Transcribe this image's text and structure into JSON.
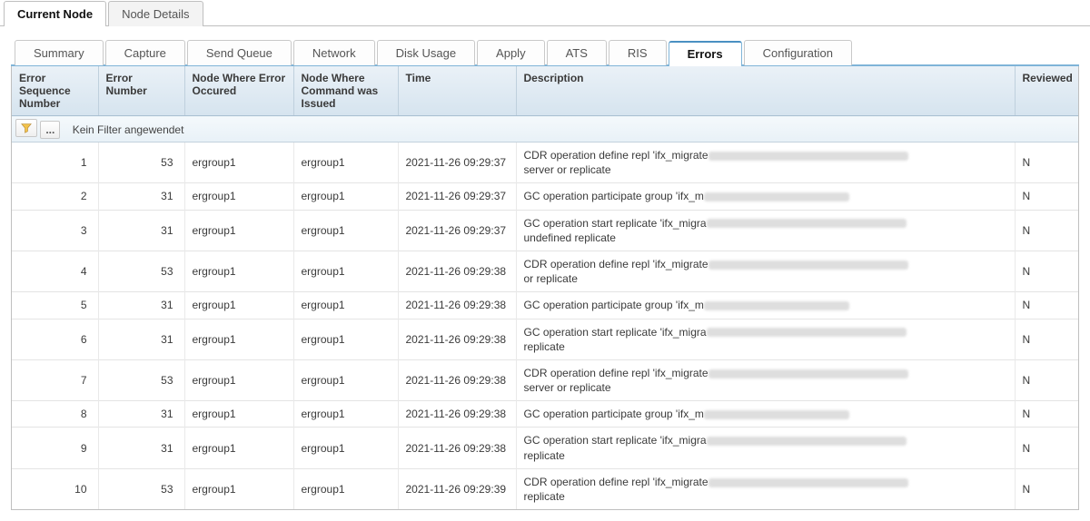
{
  "outer_tabs": {
    "current_node": "Current Node",
    "node_details": "Node Details"
  },
  "inner_tabs": {
    "summary": "Summary",
    "capture": "Capture",
    "send_queue": "Send Queue",
    "network": "Network",
    "disk_usage": "Disk Usage",
    "apply": "Apply",
    "ats": "ATS",
    "ris": "RIS",
    "errors": "Errors",
    "configuration": "Configuration"
  },
  "columns": {
    "error_seq": "Error Sequence Number",
    "error_num": "Error Number",
    "node_occurred": "Node Where Error Occured",
    "node_issued": "Node Where Command was Issued",
    "time": "Time",
    "description": "Description",
    "reviewed": "Reviewed"
  },
  "filter": {
    "text": "Kein Filter angewendet",
    "dots": "..."
  },
  "rows": [
    {
      "seq": "1",
      "err": "53",
      "nwo": "ergroup1",
      "nwc": "ergroup1",
      "time": "2021-11-26 09:29:37",
      "desc_prefix": "CDR operation define repl 'ifx_migrate",
      "desc_suffix": " server or replicate",
      "rev": "N"
    },
    {
      "seq": "2",
      "err": "31",
      "nwo": "ergroup1",
      "nwc": "ergroup1",
      "time": "2021-11-26 09:29:37",
      "desc_prefix": "GC operation participate group 'ifx_m",
      "desc_suffix": "",
      "rev": "N"
    },
    {
      "seq": "3",
      "err": "31",
      "nwo": "ergroup1",
      "nwc": "ergroup1",
      "time": "2021-11-26 09:29:37",
      "desc_prefix": "GC operation start replicate 'ifx_migra",
      "desc_suffix": " undefined replicate",
      "rev": "N"
    },
    {
      "seq": "4",
      "err": "53",
      "nwo": "ergroup1",
      "nwc": "ergroup1",
      "time": "2021-11-26 09:29:38",
      "desc_prefix": "CDR operation define repl 'ifx_migrate",
      "desc_suffix": " or replicate",
      "rev": "N"
    },
    {
      "seq": "5",
      "err": "31",
      "nwo": "ergroup1",
      "nwc": "ergroup1",
      "time": "2021-11-26 09:29:38",
      "desc_prefix": "GC operation participate group 'ifx_m",
      "desc_suffix": "",
      "rev": "N"
    },
    {
      "seq": "6",
      "err": "31",
      "nwo": "ergroup1",
      "nwc": "ergroup1",
      "time": "2021-11-26 09:29:38",
      "desc_prefix": "GC operation start replicate 'ifx_migra",
      "desc_suffix": " replicate",
      "rev": "N"
    },
    {
      "seq": "7",
      "err": "53",
      "nwo": "ergroup1",
      "nwc": "ergroup1",
      "time": "2021-11-26 09:29:38",
      "desc_prefix": "CDR operation define repl 'ifx_migrate",
      "desc_suffix": " server or replicate",
      "rev": "N"
    },
    {
      "seq": "8",
      "err": "31",
      "nwo": "ergroup1",
      "nwc": "ergroup1",
      "time": "2021-11-26 09:29:38",
      "desc_prefix": "GC operation participate group 'ifx_m",
      "desc_suffix": "",
      "rev": "N"
    },
    {
      "seq": "9",
      "err": "31",
      "nwo": "ergroup1",
      "nwc": "ergroup1",
      "time": "2021-11-26 09:29:38",
      "desc_prefix": "GC operation start replicate 'ifx_migra",
      "desc_suffix": " replicate",
      "rev": "N"
    },
    {
      "seq": "10",
      "err": "53",
      "nwo": "ergroup1",
      "nwc": "ergroup1",
      "time": "2021-11-26 09:29:39",
      "desc_prefix": "CDR operation define repl 'ifx_migrate",
      "desc_suffix": " replicate",
      "rev": "N"
    }
  ]
}
